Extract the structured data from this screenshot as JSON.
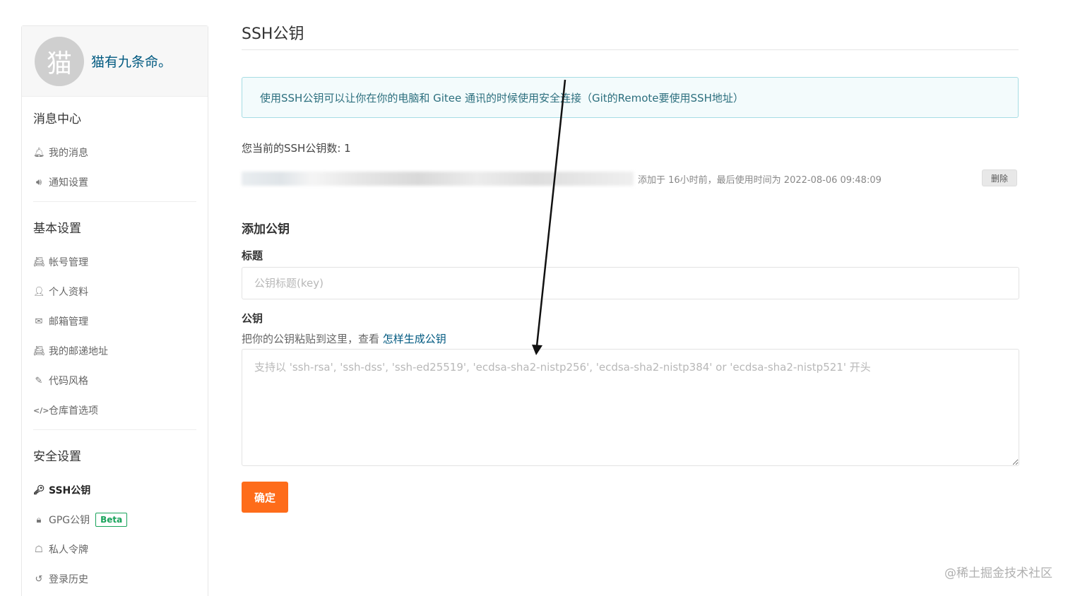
{
  "sidebar": {
    "avatar_char": "猫",
    "username": "猫有九条命。",
    "groups": [
      {
        "title": "消息中心",
        "items": [
          {
            "label": "我的消息",
            "icon": "bell-icon"
          },
          {
            "label": "通知设置",
            "icon": "speaker-icon"
          }
        ]
      },
      {
        "title": "基本设置",
        "items": [
          {
            "label": "帐号管理",
            "icon": "id-card-icon"
          },
          {
            "label": "个人资料",
            "icon": "user-icon"
          },
          {
            "label": "邮箱管理",
            "icon": "envelope-icon"
          },
          {
            "label": "我的邮递地址",
            "icon": "address-card-icon"
          },
          {
            "label": "代码风格",
            "icon": "brush-icon"
          },
          {
            "label": "仓库首选项",
            "icon": "code-icon"
          }
        ]
      },
      {
        "title": "安全设置",
        "items": [
          {
            "label": "SSH公钥",
            "icon": "key-icon",
            "active": true
          },
          {
            "label": "GPG公钥",
            "icon": "lock-icon",
            "badge": "Beta"
          },
          {
            "label": "私人令牌",
            "icon": "token-icon"
          },
          {
            "label": "登录历史",
            "icon": "history-icon"
          }
        ]
      }
    ]
  },
  "main": {
    "title": "SSH公钥",
    "info": "使用SSH公钥可以让你在你的电脑和 Gitee 通讯的时候使用安全连接（Git的Remote要使用SSH地址）",
    "count_label": "您当前的SSH公钥数: 1",
    "key": {
      "meta": "添加于 16小时前，最后使用时间为 2022-08-06 09:48:09",
      "delete_label": "删除"
    },
    "add_title": "添加公钥",
    "title_label": "标题",
    "title_placeholder": "公钥标题(key)",
    "key_label": "公钥",
    "key_hint": "把你的公钥粘贴到这里，查看",
    "key_hint_link": "怎样生成公钥",
    "key_placeholder": "支持以 'ssh-rsa', 'ssh-dss', 'ssh-ed25519', 'ecdsa-sha2-nistp256', 'ecdsa-sha2-nistp384' or 'ecdsa-sha2-nistp521' 开头",
    "submit_label": "确定"
  },
  "watermark": "@稀土掘金技术社区",
  "colors": {
    "accent": "#fe6c1a",
    "link": "#005980",
    "info_border": "#a6dce4",
    "info_bg": "#f3fbfc",
    "beta": "#19a35b"
  }
}
